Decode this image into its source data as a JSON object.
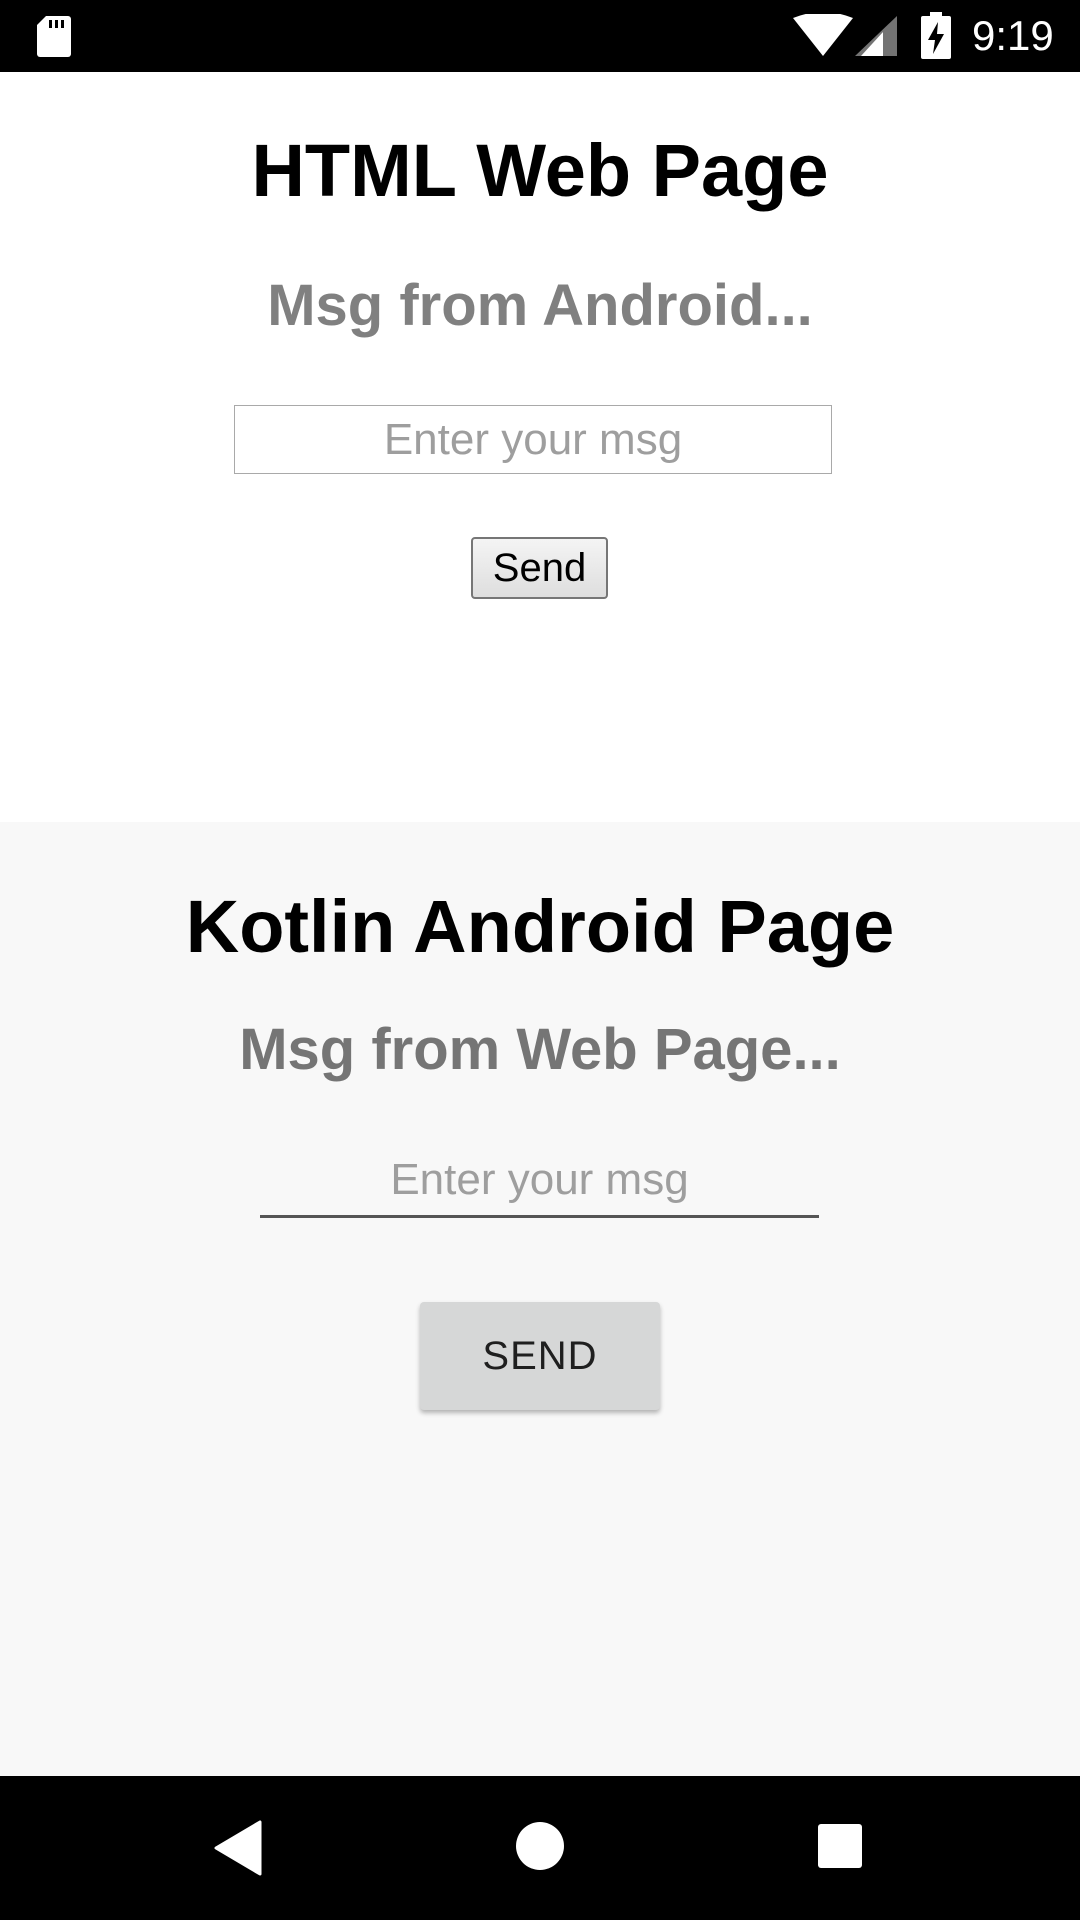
{
  "status_bar": {
    "time": "9:19",
    "icons": [
      "sd-card-icon",
      "wifi-icon",
      "signal-icon",
      "battery-charging-icon"
    ]
  },
  "web_page": {
    "title": "HTML Web Page",
    "message": "Msg from Android...",
    "input": {
      "placeholder": "Enter your msg",
      "value": ""
    },
    "send_label": "Send"
  },
  "android_page": {
    "title": "Kotlin Android Page",
    "message": "Msg from Web Page...",
    "input": {
      "placeholder": "Enter your msg",
      "value": ""
    },
    "send_label": "SEND"
  },
  "nav_bar": {
    "icons": [
      "back-icon",
      "home-icon",
      "recents-icon"
    ]
  },
  "colors": {
    "status_bar_bg": "#000000",
    "web_bg": "#ffffff",
    "android_bg": "#f8f8f8",
    "message_text": "#808080",
    "android_button_bg": "#d6d7d7"
  }
}
